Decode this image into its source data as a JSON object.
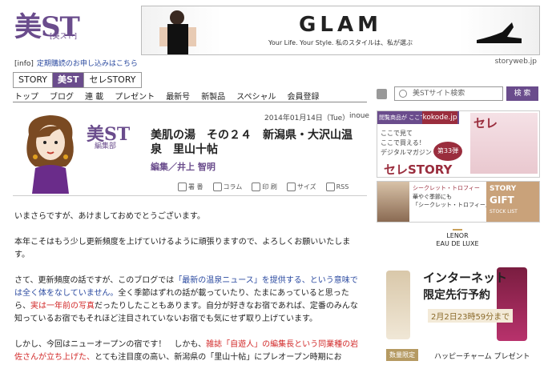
{
  "logo": {
    "main": "美ST",
    "sub": "[美スト]"
  },
  "banner": {
    "title": "GLAM",
    "tagline": "Your Life. Your Style. 私のスタイルは、私が選ぶ"
  },
  "info": {
    "tag": "[info]",
    "link": "定期購読のお申し込みはこちら",
    "site": "storyweb.jp"
  },
  "tabs": [
    "STORY",
    "美ST",
    "セレSTORY"
  ],
  "nav": [
    "トップ",
    "ブログ",
    "連 載",
    "プレゼント",
    "最新号",
    "新製品",
    "スペシャル",
    "会員登録"
  ],
  "post": {
    "date": "2014年01月14日（Tue）",
    "author_short": "inoue",
    "title": "美肌の湯　その２４　新潟県・大沢山温泉　里山十帖",
    "author": "編集／井上 智明",
    "brand": "美ST",
    "dept": "編集部"
  },
  "toolbar": [
    "署 番",
    "コラム",
    "印 刷",
    "サイズ",
    "RSS"
  ],
  "body": {
    "p1": "いまさらですが、あけましておめでとうございます。",
    "p2": "本年こそはもう少し更新頻度を上げていけるように頑張りますので、よろしくお願いいたします。",
    "p3a": "さて、更新頻度の話ですが、このブログでは",
    "p3b": "「最新の温泉ニュース」を提供する、という意味では全く体をなしていません。",
    "p3c": "全く季節はずれの話が載っていたり、たまにあっていると思ったら、",
    "p3d": "実は一年前の写真",
    "p3e": "だったりしたこともあります。自分が好きなお宿であれば、定番のみんな知っているお宿でもそれほど注目されていないお宿でも気にせず取り上げています。",
    "p4a": "しかし、今回はニューオープンの宿です！　しかも、",
    "p4b": "雑誌「自遊人」の編集長という同業種の岩佐さんが立ち上げた、",
    "p4c": "とても注目度の高い、新潟県の「里山十帖」にプレオープン時期にお"
  },
  "sidebar": {
    "search_placeholder": "美STサイト検索",
    "search_button": "検 索",
    "ad1": {
      "hdr": "閲覧商品が ここで買える",
      "kd": "kokode.jp",
      "l1": "ここで見て",
      "l2": "ここで買える！",
      "l3": "デジタルマガジン",
      "big": "セレSTORY",
      "vol": "第33弾",
      "mag": "セレ"
    },
    "ad2": {
      "t1": "シークレット・トロフィー",
      "t2": "華やぐ季節にも",
      "t3": "「シークレット・トロフィー」",
      "g1": "STORY",
      "g2": "GIFT",
      "g3": "STOCK LIST"
    },
    "ad3": {
      "lenor": "LENOR",
      "edl": "EAU DE LUXE",
      "inet": "インターネット",
      "gen": "限定先行予約",
      "dt": "2月2日23時59分まで",
      "bot1": "数量限定",
      "bot2": "ハッピーチャーム プレゼント"
    }
  },
  "colors": {
    "brand": "#6a4c8c",
    "link": "#2b4aa0",
    "highlight": "#d22a2a"
  }
}
